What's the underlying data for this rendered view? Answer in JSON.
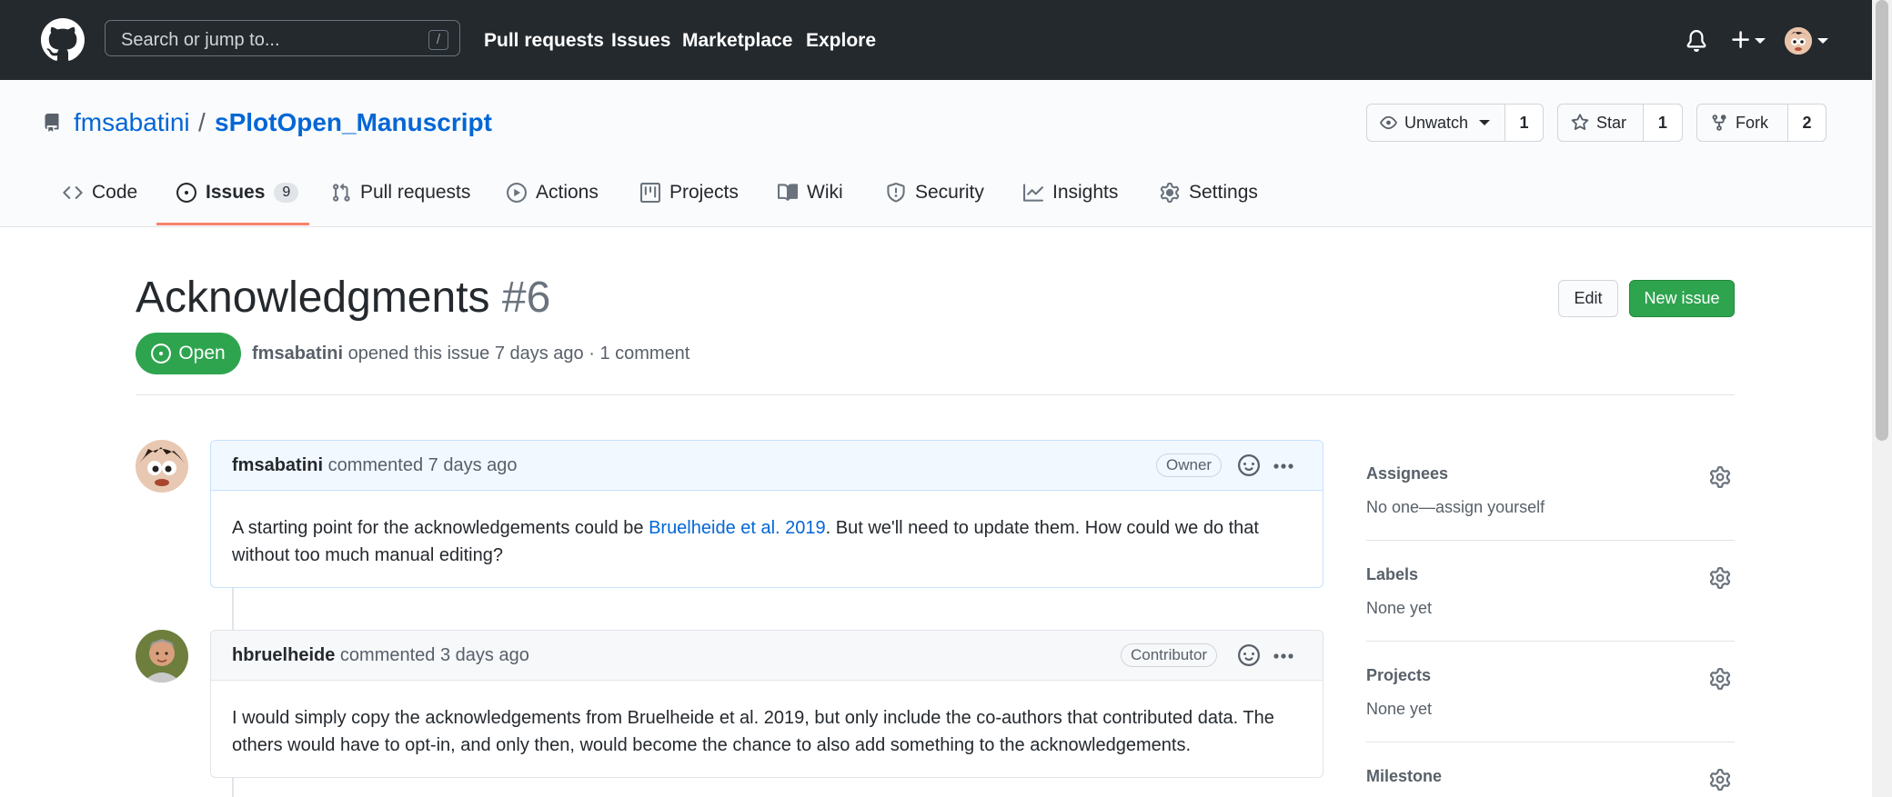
{
  "header": {
    "search_placeholder": "Search or jump to...",
    "search_shortcut": "/",
    "nav": [
      "Pull requests",
      "Issues",
      "Marketplace",
      "Explore"
    ]
  },
  "repo": {
    "owner": "fmsabatini",
    "separator": "/",
    "name": "sPlotOpen_Manuscript",
    "watch": {
      "label": "Unwatch",
      "count": "1"
    },
    "star": {
      "label": "Star",
      "count": "1"
    },
    "fork": {
      "label": "Fork",
      "count": "2"
    }
  },
  "tabs": {
    "code": "Code",
    "issues": "Issues",
    "issues_count": "9",
    "pulls": "Pull requests",
    "actions": "Actions",
    "projects": "Projects",
    "wiki": "Wiki",
    "security": "Security",
    "insights": "Insights",
    "settings": "Settings"
  },
  "issue": {
    "title": "Acknowledgments",
    "number": "#6",
    "edit_label": "Edit",
    "new_label": "New issue",
    "state": "Open",
    "author": "fmsabatini",
    "meta_rest": "opened this issue 7 days ago · 1 comment"
  },
  "comments": [
    {
      "author": "fmsabatini",
      "action": "commented 7 days ago",
      "role": "Owner",
      "body_before": "A starting point for the acknowledgements could be ",
      "link": "Bruelheide et al. 2019",
      "body_after": ". But we'll need to update them. How could we do that without too much manual editing?"
    },
    {
      "author": "hbruelheide",
      "action": "commented 3 days ago",
      "role": "Contributor",
      "body": "I would simply copy the acknowledgements from Bruelheide et al. 2019, but only include the co-authors that contributed data. The others would have to opt-in, and only then, would become the chance to also add something to the acknowledgements."
    }
  ],
  "sidebar": {
    "assignees": {
      "title": "Assignees",
      "value": "No one—assign yourself"
    },
    "labels": {
      "title": "Labels",
      "value": "None yet"
    },
    "projects": {
      "title": "Projects",
      "value": "None yet"
    },
    "milestone": {
      "title": "Milestone"
    }
  },
  "colors": {
    "header_bg": "#24292e",
    "link": "#0366d6",
    "open_green": "#2ea44f",
    "tab_underline": "#f9826c"
  }
}
